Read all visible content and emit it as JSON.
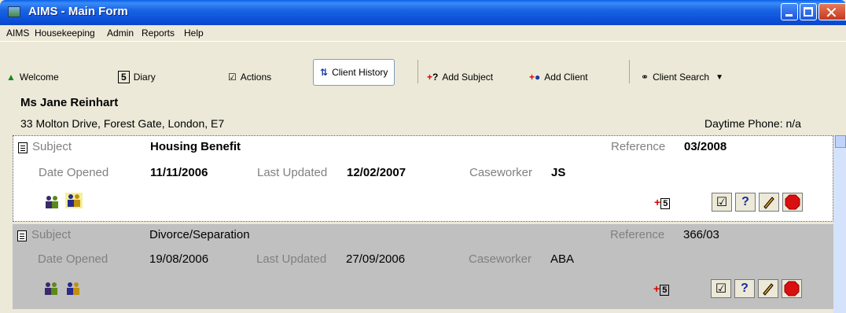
{
  "window": {
    "title": "AIMS - Main Form"
  },
  "menu": [
    "AIMS",
    "Housekeeping",
    "Admin",
    "Reports",
    "Help"
  ],
  "toolbar": {
    "welcome": "Welcome",
    "diary": "Diary",
    "actions": "Actions",
    "client_history": "Client History",
    "add_subject": "Add Subject",
    "add_client": "Add Client",
    "client_search": "Client Search"
  },
  "client": {
    "name": "Ms Jane Reinhart",
    "address": "33 Molton Drive, Forest Gate, London, E7",
    "phone": "Daytime Phone: n/a"
  },
  "labels": {
    "subject": "Subject",
    "reference": "Reference",
    "date_opened": "Date Opened",
    "last_updated": "Last Updated",
    "caseworker": "Caseworker"
  },
  "cases": [
    {
      "subject": "Housing Benefit",
      "reference": "03/2008",
      "date_opened": "11/11/2006",
      "last_updated": "12/02/2007",
      "caseworker": "JS"
    },
    {
      "subject": "Divorce/Separation",
      "reference": "366/03",
      "date_opened": "19/08/2006",
      "last_updated": "27/09/2006",
      "caseworker": "ABA"
    }
  ],
  "buttons": {
    "help": "?",
    "diary_num": "5"
  }
}
